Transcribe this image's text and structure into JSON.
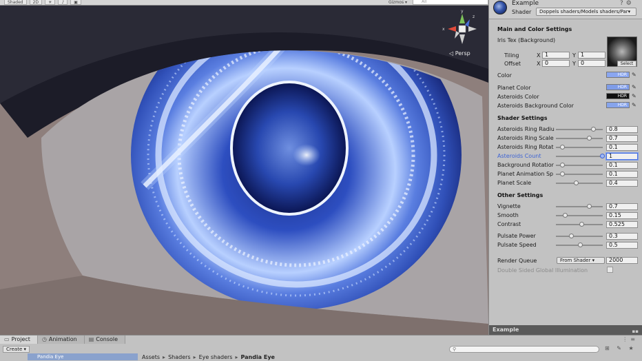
{
  "scene": {
    "toolbar": {
      "shading_mode": "Shaded",
      "mode_2d": "2D",
      "gizmos_label": "Gizmos ▾",
      "search_placeholder": "All"
    },
    "persp_label": "◁ Persp",
    "gizmo_axes": {
      "x": "x",
      "y": "y",
      "z": "z"
    }
  },
  "inspector": {
    "material_name": "Example",
    "shader_label": "Shader",
    "shader_value": "Doppels shaders/Models shaders/Par▾",
    "sections": {
      "main": "Main and Color Settings",
      "shader": "Shader Settings",
      "other": "Other Settings"
    },
    "iris_tex": {
      "label": "Iris Tex (Background)",
      "select_label": "Select",
      "tiling_label": "Tiling",
      "offset_label": "Offset",
      "tiling_x": "1",
      "tiling_y": "1",
      "offset_x": "0",
      "offset_y": "0"
    },
    "colors": [
      {
        "label": "Color",
        "badge": "HDR",
        "color": "#8aa6f0"
      },
      {
        "label": "Planet Color",
        "badge": "HDR",
        "color": "#7f9ce8"
      },
      {
        "label": "Asteroids Color",
        "badge": "HDR",
        "color": "#101010"
      },
      {
        "label": "Asteroids Background Color",
        "badge": "HDR",
        "color": "#86a4ec"
      }
    ],
    "shader_settings": [
      {
        "label": "Asteroids Ring Radiu",
        "value": "0.8",
        "fraction": 0.8
      },
      {
        "label": "Asteroids Ring Scale",
        "value": "0.7",
        "fraction": 0.7
      },
      {
        "label": "Asteroids Ring Rotat",
        "value": "0.1",
        "fraction": 0.1
      },
      {
        "label": "Asteroids Count",
        "value": "1",
        "fraction": 1.0
      },
      {
        "label": "Background Rotatior",
        "value": "0.1",
        "fraction": 0.1
      },
      {
        "label": "Planet Animation Sp",
        "value": "0.1",
        "fraction": 0.1
      },
      {
        "label": "Planet Scale",
        "value": "0.4",
        "fraction": 0.4
      }
    ],
    "other_settings": [
      {
        "label": "Vignette",
        "value": "0.7",
        "fraction": 0.7
      },
      {
        "label": "Smooth",
        "value": "0.15",
        "fraction": 0.15
      },
      {
        "label": "Contrast",
        "value": "0.525",
        "fraction": 0.525
      },
      {
        "label": "Pulsate Power",
        "value": "0.3",
        "fraction": 0.3
      },
      {
        "label": "Pulsate Speed",
        "value": "0.5",
        "fraction": 0.5
      }
    ],
    "render_queue": {
      "label": "Render Queue",
      "select": "From Shader ▾",
      "value": "2000"
    },
    "dsgi_label": "Double Sided Global Illumination",
    "preview_title": "Example",
    "preview_icons": "▪▪"
  },
  "bottom": {
    "tabs": [
      {
        "icon": "▭",
        "label": "Project"
      },
      {
        "icon": "◷",
        "label": "Animation"
      },
      {
        "icon": "▤",
        "label": "Console"
      }
    ],
    "panel_icons": "⋮≡",
    "create_label": "Create ▾",
    "search_placeholder": "⚲",
    "tools": "⊞ ✎ ★",
    "tree_item": "Pandia Eye",
    "breadcrumb": [
      "Assets",
      "Shaders",
      "Eye shaders",
      "Pandia Eye"
    ]
  }
}
